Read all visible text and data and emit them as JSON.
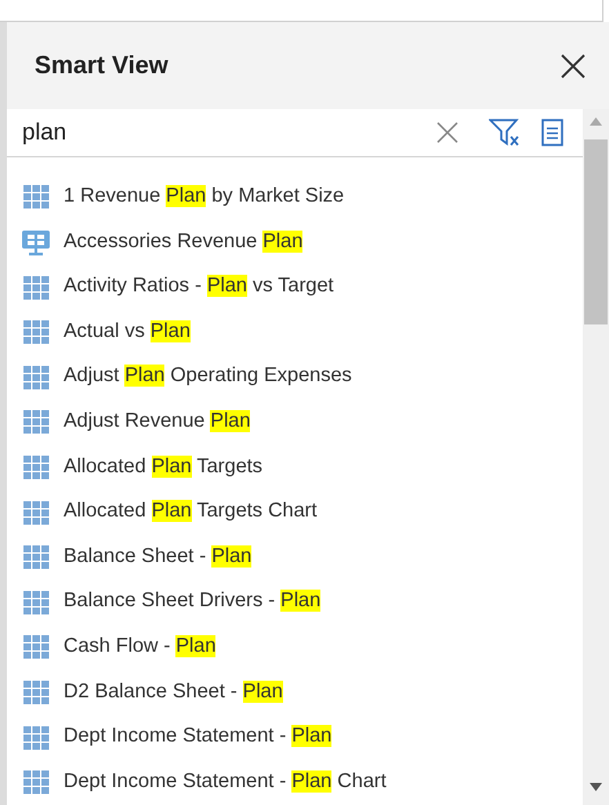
{
  "panel": {
    "title": "Smart View"
  },
  "search": {
    "value": "plan"
  },
  "items": [
    {
      "kind": "grid",
      "before": "1 Revenue ",
      "match": "Plan",
      "after": " by Market Size"
    },
    {
      "kind": "monitor",
      "before": "Accessories Revenue ",
      "match": "Plan"
    },
    {
      "kind": "grid",
      "before": "Activity Ratios - ",
      "match": "Plan",
      "after": " vs Target"
    },
    {
      "kind": "grid",
      "before": "Actual vs ",
      "match": "Plan"
    },
    {
      "kind": "grid",
      "before": "Adjust ",
      "match": "Plan",
      "after": " Operating Expenses"
    },
    {
      "kind": "grid",
      "before": "Adjust Revenue ",
      "match": "Plan"
    },
    {
      "kind": "grid",
      "before": "Allocated ",
      "match": "Plan",
      "after": " Targets"
    },
    {
      "kind": "grid",
      "before": "Allocated ",
      "match": "Plan",
      "after": " Targets Chart"
    },
    {
      "kind": "grid",
      "before": "Balance Sheet - ",
      "match": "Plan"
    },
    {
      "kind": "grid",
      "before": "Balance Sheet Drivers - ",
      "match": "Plan"
    },
    {
      "kind": "grid",
      "before": "Cash Flow - ",
      "match": "Plan"
    },
    {
      "kind": "grid",
      "before": "D2 Balance Sheet - ",
      "match": "Plan"
    },
    {
      "kind": "grid",
      "before": "Dept Income Statement - ",
      "match": "Plan"
    },
    {
      "kind": "grid",
      "before": "Dept Income Statement - ",
      "match": "Plan",
      "after": " Chart"
    }
  ]
}
